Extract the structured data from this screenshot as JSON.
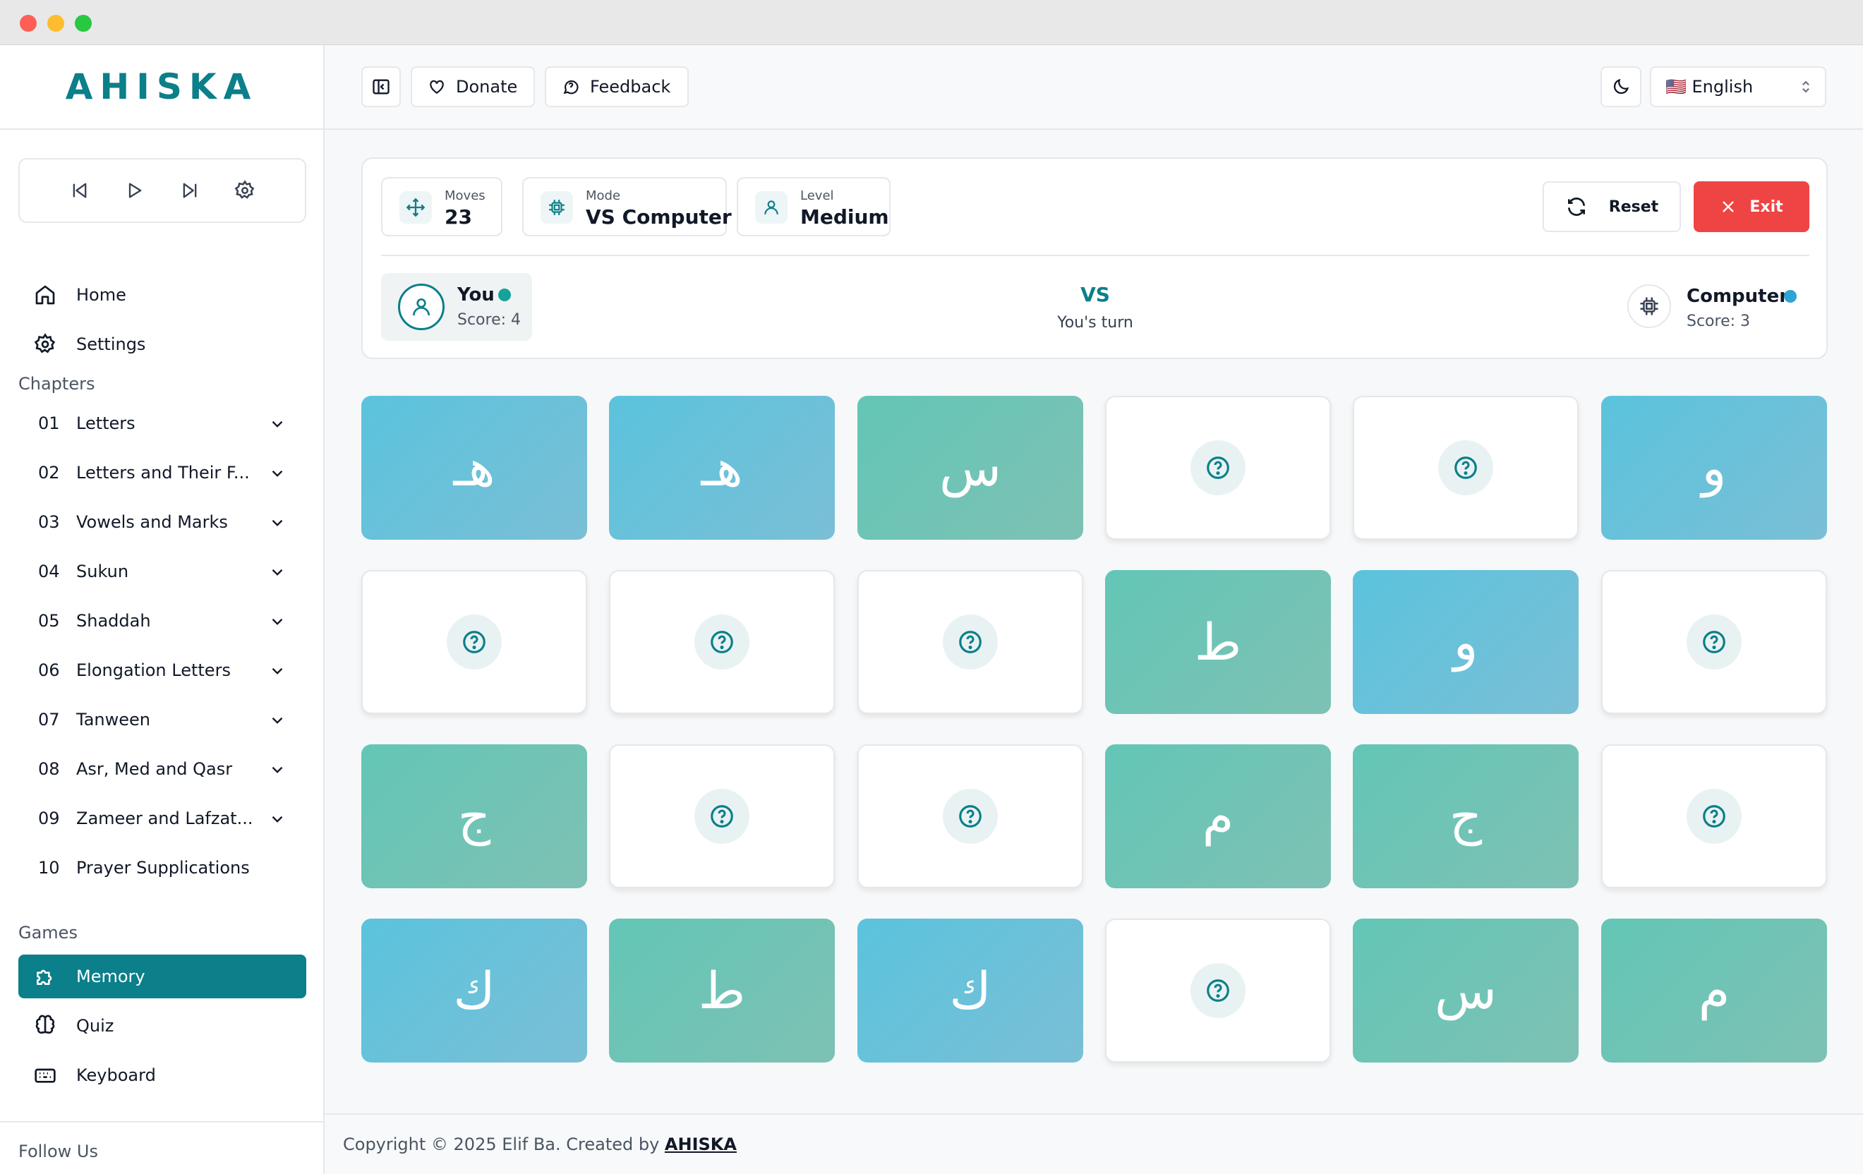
{
  "brand": {
    "logo": "AHISKA"
  },
  "nav": {
    "home": "Home",
    "settings": "Settings"
  },
  "sections": {
    "chapters": "Chapters",
    "games": "Games",
    "follow": "Follow Us"
  },
  "chapters": [
    {
      "num": "01",
      "title": "Letters"
    },
    {
      "num": "02",
      "title": "Letters and Their F..."
    },
    {
      "num": "03",
      "title": "Vowels and Marks"
    },
    {
      "num": "04",
      "title": "Sukun"
    },
    {
      "num": "05",
      "title": "Shaddah"
    },
    {
      "num": "06",
      "title": "Elongation Letters"
    },
    {
      "num": "07",
      "title": "Tanween"
    },
    {
      "num": "08",
      "title": "Asr, Med and Qasr"
    },
    {
      "num": "09",
      "title": "Zameer and Lafzat..."
    },
    {
      "num": "10",
      "title": "Prayer Supplications"
    }
  ],
  "games": {
    "memory": "Memory",
    "quiz": "Quiz",
    "keyboard": "Keyboard"
  },
  "header": {
    "donate": "Donate",
    "feedback": "Feedback",
    "language": "🇺🇸 English"
  },
  "stats": {
    "moves_label": "Moves",
    "moves_value": "23",
    "mode_label": "Mode",
    "mode_value": "VS Computer",
    "level_label": "Level",
    "level_value": "Medium"
  },
  "actions": {
    "reset": "Reset",
    "exit": "Exit"
  },
  "players": {
    "you_name": "You",
    "you_score": "Score: 4",
    "vs": "VS",
    "turn": "You's turn",
    "computer_name": "Computer",
    "computer_score": "Score: 3"
  },
  "board": [
    [
      "هـ",
      "هـ",
      "س",
      "",
      "",
      "و"
    ],
    [
      "",
      "",
      "",
      "ط",
      "و",
      ""
    ],
    [
      "ج",
      "",
      "",
      "م",
      "ج",
      ""
    ],
    [
      "ك",
      "ط",
      "ك",
      "",
      "س",
      "م"
    ]
  ],
  "footer": {
    "text": "Copyright © 2025 Elif Ba. Created by ",
    "link": "AHISKA"
  },
  "colors": {
    "accent": "#0b7f8a",
    "exit": "#ef4444",
    "you_dot": "#14a39a",
    "computer_dot": "#2fa3d6"
  }
}
